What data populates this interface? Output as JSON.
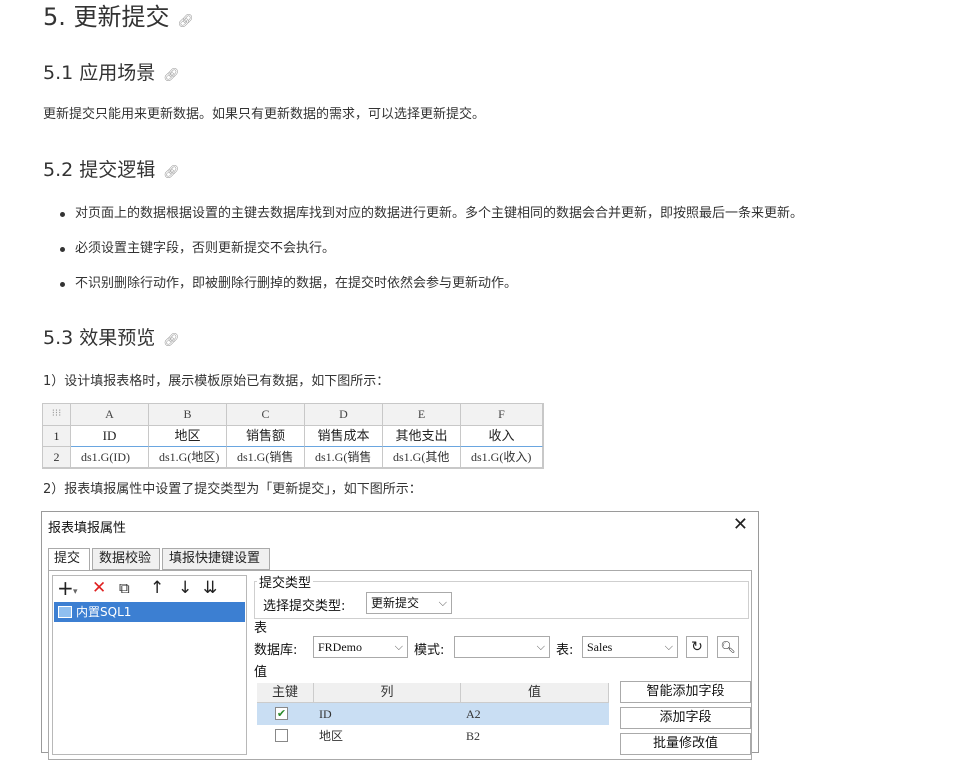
{
  "doc": {
    "h1": "5. 更新提交",
    "s1_title": "5.1 应用场景",
    "s1_text": "更新提交只能用来更新数据。如果只有更新数据的需求，可以选择更新提交。",
    "s2_title": "5.2 提交逻辑",
    "s2_bullets": [
      "对页面上的数据根据设置的主键去数据库找到对应的数据进行更新。多个主键相同的数据会合并更新，即按照最后一条来更新。",
      "必须设置主键字段，否则更新提交不会执行。",
      "不识别删除行动作，即被删除行删掉的数据，在提交时依然会参与更新动作。"
    ],
    "s3_title": "5.3 效果预览",
    "s3_p1": "1）设计填报表格时，展示模板原始已有数据，如下图所示：",
    "s3_p2": "2）报表填报属性中设置了提交类型为「更新提交」，如下图所示：",
    "anchor_icon": "link-icon"
  },
  "sheet": {
    "corner": "⁝⁝⁝",
    "cols": [
      "A",
      "B",
      "C",
      "D",
      "E",
      "F"
    ],
    "row_nums": [
      "1",
      "2"
    ],
    "row1": [
      "ID",
      "地区",
      "销售额",
      "销售成本",
      "其他支出",
      "收入"
    ],
    "row2": [
      "ds1.G(ID)",
      "ds1.G(地区)",
      "ds1.G(销售",
      "ds1.G(销售",
      "ds1.G(其他",
      "ds1.G(收入)"
    ]
  },
  "dialog": {
    "title": "报表填报属性",
    "close": "✕",
    "tabs": [
      "提交",
      "数据校验",
      "填报快捷键设置"
    ],
    "toolbar": [
      "+",
      "▾",
      "✕",
      "⧉",
      "↑",
      "↓",
      "⇊"
    ],
    "tree_item": "内置SQL1",
    "group_submit_type": "提交类型",
    "select_type_label": "选择提交类型:",
    "select_type_value": "更新提交",
    "group_table": "表",
    "db_label": "数据库:",
    "db_value": "FRDemo",
    "mode_label": "模式:",
    "mode_value": "",
    "table_label": "表:",
    "table_value": "Sales",
    "group_value": "值",
    "grid_headers": [
      "主键",
      "列",
      "值"
    ],
    "grid_rows": [
      {
        "key": "✔",
        "col": "ID",
        "val": "A2"
      },
      {
        "key": "",
        "col": "地区",
        "val": "B2"
      }
    ],
    "buttons": [
      "智能添加字段",
      "添加字段",
      "批量修改值"
    ]
  }
}
